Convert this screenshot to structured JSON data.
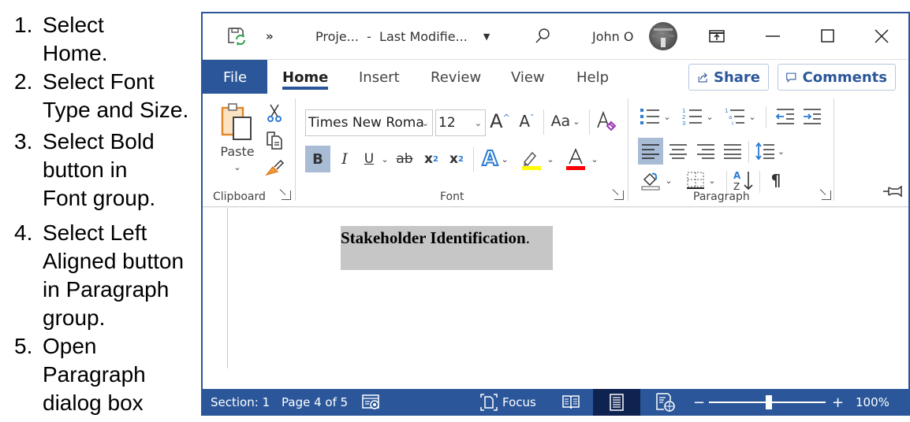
{
  "instructions": [
    {
      "num": "1.",
      "lines": [
        "Select",
        "Home."
      ]
    },
    {
      "num": "2.",
      "lines": [
        "Select Font",
        "Type and Size."
      ]
    },
    {
      "num": "3.",
      "lines": [
        "Select Bold",
        "button in",
        "Font group."
      ]
    },
    {
      "num": "4.",
      "lines": [
        "Select Left",
        "Aligned button",
        "in Paragraph",
        "group."
      ]
    },
    {
      "num": "5.",
      "lines": [
        "Open",
        "Paragraph",
        "dialog box"
      ]
    }
  ],
  "titlebar": {
    "overflow": "»",
    "title": "Proje...  -  Last Modifie...",
    "user": "John O"
  },
  "tabs": {
    "file": "File",
    "home": "Home",
    "insert": "Insert",
    "review": "Review",
    "view": "View",
    "help": "Help",
    "share": "Share",
    "comments": "Comments"
  },
  "ribbon": {
    "clipboard": {
      "label": "Clipboard",
      "paste": "Paste"
    },
    "font": {
      "label": "Font",
      "font_name": "Times New Roma",
      "font_size": "12",
      "change_case": "Aa",
      "bold": "B",
      "italic": "I",
      "underline": "U",
      "strikethrough": "ab",
      "subscript": "x",
      "superscript": "x",
      "highlight_color": "#ffff00",
      "font_color": "#ff0000"
    },
    "paragraph": {
      "label": "Paragraph",
      "active_alignment": "left"
    }
  },
  "document": {
    "selected_text": "Stakeholder Identification",
    "trailing": "."
  },
  "statusbar": {
    "section": "Section: 1",
    "page": "Page 4 of 5",
    "focus": "Focus",
    "zoom_minus": "−",
    "zoom_plus": "+",
    "zoom_level": "100%",
    "zoom_slider_fraction": 0.5,
    "active_view": "print-layout"
  },
  "colors": {
    "brand": "#2b579a",
    "selection": "#c6c6c6",
    "button_active": "#a8bcd6",
    "active_view": "#0f2350"
  }
}
